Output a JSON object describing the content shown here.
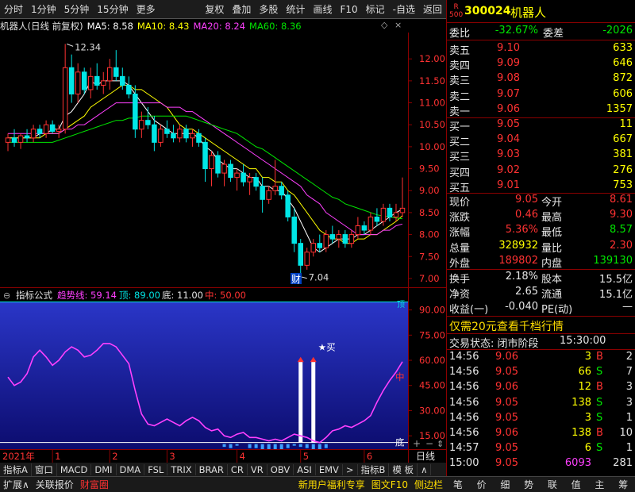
{
  "toolbar": {
    "left": [
      "分时",
      "1分钟",
      "5分钟",
      "15分钟",
      "更多"
    ],
    "right": [
      "复权",
      "叠加",
      "多股",
      "统计",
      "画线",
      "F10",
      "标记",
      "-自选",
      "返回"
    ]
  },
  "chart_header": {
    "name": "机器人(日线 前复权)",
    "ma": [
      {
        "label": "MA5: 8.58",
        "color": "#ffffff"
      },
      {
        "label": "MA10: 8.43",
        "color": "#ffff00"
      },
      {
        "label": "MA20: 8.24",
        "color": "#ff40ff"
      },
      {
        "label": "MA60: 8.36",
        "color": "#00e600"
      }
    ]
  },
  "indicator_header": {
    "name": "指标公式",
    "trend": "趋势线: 59.14",
    "top": "顶: 89.00",
    "bottom": "底: 11.00",
    "mid": "中: 50.00"
  },
  "annotations": {
    "high": "12.34",
    "low": "7.04",
    "cai": "财",
    "buy": "★买",
    "ind_mid": "中",
    "ind_bottom": "底",
    "ind_top": "顶"
  },
  "chart_data": [
    {
      "type": "candlestick",
      "ylim": [
        6.8,
        12.6
      ],
      "yticks": [
        "12.00",
        "11.50",
        "11.00",
        "10.50",
        "10.00",
        "9.50",
        "9.00",
        "8.50",
        "8.00",
        "7.50",
        "7.00"
      ],
      "ytick_values": [
        12,
        11.5,
        11,
        10.5,
        10,
        9.5,
        9,
        8.5,
        8,
        7.5,
        7
      ],
      "ohlc": [
        [
          10.1,
          10.3,
          9.9,
          10.2
        ],
        [
          10.2,
          10.4,
          10.0,
          10.1
        ],
        [
          10.1,
          10.3,
          9.95,
          10.25
        ],
        [
          10.25,
          10.4,
          10.1,
          10.2
        ],
        [
          10.2,
          10.5,
          10.1,
          10.4
        ],
        [
          10.4,
          10.5,
          10.2,
          10.3
        ],
        [
          10.3,
          10.6,
          10.2,
          10.5
        ],
        [
          10.5,
          10.6,
          10.3,
          10.35
        ],
        [
          10.35,
          10.5,
          10.2,
          10.4
        ],
        [
          10.4,
          12.34,
          10.3,
          11.8
        ],
        [
          11.8,
          12.1,
          11.0,
          11.2
        ],
        [
          11.2,
          11.9,
          11.0,
          11.7
        ],
        [
          11.7,
          11.8,
          11.2,
          11.3
        ],
        [
          11.3,
          11.8,
          11.1,
          11.6
        ],
        [
          11.6,
          11.9,
          11.3,
          11.4
        ],
        [
          11.4,
          11.7,
          11.2,
          11.5
        ],
        [
          11.5,
          12.0,
          11.3,
          11.8
        ],
        [
          11.8,
          12.2,
          11.5,
          11.6
        ],
        [
          11.6,
          11.8,
          11.3,
          11.4
        ],
        [
          11.4,
          11.6,
          11.1,
          11.2
        ],
        [
          11.2,
          11.4,
          10.2,
          10.4
        ],
        [
          10.4,
          10.8,
          10.2,
          10.6
        ],
        [
          10.6,
          10.9,
          10.4,
          10.5
        ],
        [
          10.5,
          10.7,
          9.9,
          10.1
        ],
        [
          10.1,
          10.5,
          10.0,
          10.4
        ],
        [
          10.4,
          10.6,
          10.2,
          10.3
        ],
        [
          10.3,
          10.5,
          10.1,
          10.2
        ],
        [
          10.2,
          10.5,
          10.1,
          10.4
        ],
        [
          10.4,
          10.5,
          10.1,
          10.2
        ],
        [
          10.2,
          10.4,
          10.0,
          10.3
        ],
        [
          10.3,
          10.4,
          10.0,
          10.1
        ],
        [
          10.1,
          10.2,
          9.2,
          9.5
        ],
        [
          9.5,
          9.9,
          9.1,
          9.8
        ],
        [
          9.8,
          9.9,
          9.3,
          9.4
        ],
        [
          9.4,
          9.7,
          9.1,
          9.6
        ],
        [
          9.6,
          9.7,
          9.2,
          9.3
        ],
        [
          9.3,
          9.5,
          9.0,
          9.4
        ],
        [
          9.4,
          9.6,
          9.1,
          9.2
        ],
        [
          9.2,
          9.4,
          8.9,
          9.3
        ],
        [
          9.3,
          9.4,
          9.0,
          9.1
        ],
        [
          9.1,
          9.3,
          8.5,
          8.8
        ],
        [
          8.8,
          9.1,
          8.7,
          9.0
        ],
        [
          9.0,
          9.7,
          8.9,
          9.1
        ],
        [
          9.1,
          9.2,
          8.8,
          8.9
        ],
        [
          8.9,
          9.0,
          8.3,
          8.4
        ],
        [
          8.4,
          8.6,
          7.6,
          7.8
        ],
        [
          7.8,
          7.9,
          7.04,
          7.3
        ],
        [
          7.3,
          7.7,
          7.2,
          7.6
        ],
        [
          7.6,
          7.9,
          7.5,
          7.8
        ],
        [
          7.8,
          8.0,
          7.6,
          7.7
        ],
        [
          7.7,
          8.1,
          7.6,
          8.0
        ],
        [
          8.0,
          8.2,
          7.8,
          7.9
        ],
        [
          7.9,
          8.1,
          7.7,
          8.0
        ],
        [
          8.0,
          8.1,
          7.7,
          7.8
        ],
        [
          7.8,
          8.1,
          7.7,
          8.0
        ],
        [
          8.0,
          8.4,
          7.9,
          8.2
        ],
        [
          8.2,
          8.3,
          8.0,
          8.1
        ],
        [
          8.1,
          8.5,
          8.0,
          8.4
        ],
        [
          8.4,
          8.6,
          8.2,
          8.3
        ],
        [
          8.3,
          8.7,
          8.2,
          8.6
        ],
        [
          8.6,
          8.7,
          8.3,
          8.4
        ],
        [
          8.4,
          8.7,
          8.3,
          8.5
        ],
        [
          8.5,
          9.3,
          8.4,
          8.6
        ]
      ],
      "ma_series": [
        {
          "name": "MA5",
          "color": "#ffffff",
          "values": [
            10.2,
            10.2,
            10.2,
            10.2,
            10.2,
            10.3,
            10.3,
            10.4,
            10.4,
            10.7,
            10.8,
            11.0,
            11.2,
            11.5,
            11.4,
            11.5,
            11.5,
            11.5,
            11.5,
            11.4,
            11.2,
            11.0,
            10.8,
            10.6,
            10.5,
            10.4,
            10.3,
            10.3,
            10.3,
            10.3,
            10.2,
            10.0,
            9.9,
            9.7,
            9.6,
            9.5,
            9.5,
            9.4,
            9.3,
            9.3,
            9.1,
            9.1,
            9.0,
            9.0,
            8.8,
            8.6,
            8.3,
            8.0,
            7.7,
            7.6,
            7.7,
            7.8,
            7.9,
            7.9,
            7.9,
            8.0,
            8.0,
            8.1,
            8.2,
            8.3,
            8.4,
            8.5,
            8.58
          ]
        },
        {
          "name": "MA10",
          "color": "#ffff00",
          "values": [
            10.2,
            10.2,
            10.2,
            10.2,
            10.2,
            10.2,
            10.3,
            10.3,
            10.3,
            10.4,
            10.5,
            10.6,
            10.7,
            10.9,
            11.0,
            11.1,
            11.2,
            11.3,
            11.4,
            11.4,
            11.3,
            11.3,
            11.2,
            11.1,
            11.0,
            10.9,
            10.7,
            10.5,
            10.4,
            10.4,
            10.3,
            10.2,
            10.1,
            10.0,
            9.9,
            9.8,
            9.7,
            9.6,
            9.5,
            9.5,
            9.3,
            9.3,
            9.2,
            9.2,
            9.0,
            8.9,
            8.7,
            8.5,
            8.3,
            8.1,
            8.0,
            7.9,
            7.9,
            7.8,
            7.8,
            7.9,
            7.9,
            8.0,
            8.0,
            8.1,
            8.2,
            8.3,
            8.43
          ]
        },
        {
          "name": "MA20",
          "color": "#ff40ff",
          "values": [
            10.3,
            10.3,
            10.3,
            10.3,
            10.3,
            10.3,
            10.3,
            10.3,
            10.3,
            10.4,
            10.4,
            10.5,
            10.5,
            10.6,
            10.7,
            10.8,
            10.9,
            11.0,
            11.0,
            11.0,
            11.0,
            11.0,
            11.0,
            11.0,
            11.0,
            10.9,
            10.9,
            10.9,
            10.8,
            10.8,
            10.7,
            10.6,
            10.5,
            10.4,
            10.3,
            10.2,
            10.1,
            10.0,
            9.9,
            9.8,
            9.7,
            9.6,
            9.5,
            9.4,
            9.3,
            9.2,
            9.1,
            8.9,
            8.8,
            8.7,
            8.5,
            8.4,
            8.3,
            8.2,
            8.1,
            8.0,
            8.0,
            8.0,
            8.0,
            8.1,
            8.1,
            8.2,
            8.24
          ]
        },
        {
          "name": "MA60",
          "color": "#00e600",
          "values": [
            10.1,
            10.1,
            10.1,
            10.1,
            10.1,
            10.1,
            10.1,
            10.1,
            10.15,
            10.2,
            10.25,
            10.3,
            10.35,
            10.4,
            10.45,
            10.5,
            10.55,
            10.6,
            10.6,
            10.65,
            10.65,
            10.7,
            10.7,
            10.7,
            10.7,
            10.7,
            10.7,
            10.7,
            10.7,
            10.65,
            10.6,
            10.55,
            10.5,
            10.45,
            10.4,
            10.35,
            10.3,
            10.2,
            10.1,
            10.0,
            9.95,
            9.85,
            9.75,
            9.65,
            9.55,
            9.45,
            9.35,
            9.25,
            9.15,
            9.05,
            8.95,
            8.85,
            8.8,
            8.7,
            8.65,
            8.6,
            8.55,
            8.5,
            8.45,
            8.42,
            8.4,
            8.38,
            8.36
          ]
        }
      ]
    },
    {
      "type": "line",
      "ylim": [
        8,
        95
      ],
      "yticks": [
        "90.00",
        "75.00",
        "60.00",
        "45.00",
        "30.00",
        "15.00"
      ],
      "ytick_values": [
        90,
        75,
        60,
        45,
        30,
        15
      ],
      "series": [
        {
          "name": "趋势线",
          "color": "#ff40ff",
          "values": [
            50,
            45,
            47,
            52,
            62,
            66,
            62,
            57,
            60,
            65,
            68,
            66,
            62,
            63,
            66,
            70,
            70,
            68,
            63,
            58,
            42,
            28,
            22,
            21,
            23,
            25,
            23,
            21,
            24,
            26,
            24,
            20,
            18,
            19,
            15,
            14,
            16,
            17,
            14,
            14,
            13,
            12,
            13,
            12,
            14,
            16,
            15,
            14,
            12,
            11,
            14,
            18,
            19,
            21,
            20,
            22,
            24,
            27,
            35,
            42,
            48,
            53,
            59.14
          ]
        }
      ],
      "mid_line": 50,
      "bottom_line": 11
    }
  ],
  "x_axis": {
    "year": "2021年",
    "months": [
      "1",
      "2",
      "3",
      "4",
      "5",
      "6"
    ],
    "period": "日线"
  },
  "indicator_tabs": [
    "指标A",
    "窗口",
    "MACD",
    "DMI",
    "DMA",
    "FSL",
    "TRIX",
    "BRAR",
    "CR",
    "VR",
    "OBV",
    "ASI",
    "EMV",
    "指标B",
    "模 板"
  ],
  "status_left": [
    "扩展∧",
    "关联报价",
    "财富圈"
  ],
  "status_right": [
    "新用户福利专享",
    "图文F10",
    "侧边栏"
  ],
  "status_icons": [
    "笔",
    "价",
    "细",
    "势",
    "联",
    "值",
    "主",
    "筹"
  ],
  "stock": {
    "code": "300024",
    "name": "机器人",
    "badge_top": "R",
    "badge_bottom": "500",
    "weibi_label": "委比",
    "weibi": "-32.67%",
    "weicha_label": "委差",
    "weicha": "-2026"
  },
  "asks": [
    {
      "label": "卖五",
      "price": "9.10",
      "vol": "633"
    },
    {
      "label": "卖四",
      "price": "9.09",
      "vol": "646"
    },
    {
      "label": "卖三",
      "price": "9.08",
      "vol": "872"
    },
    {
      "label": "卖二",
      "price": "9.07",
      "vol": "606"
    },
    {
      "label": "卖一",
      "price": "9.06",
      "vol": "1357"
    }
  ],
  "bids": [
    {
      "label": "买一",
      "price": "9.05",
      "vol": "11"
    },
    {
      "label": "买二",
      "price": "9.04",
      "vol": "667"
    },
    {
      "label": "买三",
      "price": "9.03",
      "vol": "381"
    },
    {
      "label": "买四",
      "price": "9.02",
      "vol": "276"
    },
    {
      "label": "买五",
      "price": "9.01",
      "vol": "753"
    }
  ],
  "quote": [
    {
      "l1": "现价",
      "v1": "9.05",
      "c1": "#ff3232",
      "l2": "今开",
      "v2": "8.61",
      "c2": "#ff3232"
    },
    {
      "l1": "涨跌",
      "v1": "0.46",
      "c1": "#ff3232",
      "l2": "最高",
      "v2": "9.30",
      "c2": "#ff3232"
    },
    {
      "l1": "涨幅",
      "v1": "5.36%",
      "c1": "#ff3232",
      "l2": "最低",
      "v2": "8.57",
      "c2": "#00e600"
    },
    {
      "l1": "总量",
      "v1": "328932",
      "c1": "#ffff00",
      "l2": "量比",
      "v2": "2.30",
      "c2": "#ff3232"
    },
    {
      "l1": "外盘",
      "v1": "189802",
      "c1": "#ff3232",
      "l2": "内盘",
      "v2": "139130",
      "c2": "#00e600"
    }
  ],
  "stats": [
    {
      "l1": "换手",
      "v1": "2.18%",
      "l2": "股本",
      "v2": "15.5亿"
    },
    {
      "l1": "净资",
      "v1": "2.65",
      "l2": "流通",
      "v2": "15.1亿"
    },
    {
      "l1": "收益(一)",
      "v1": "-0.040",
      "l2": "PE(动)",
      "v2": "—"
    }
  ],
  "promo": "仅需20元查看千档行情",
  "trade_status_label": "交易状态: 闭市阶段",
  "trade_status_time": "15:30:00",
  "ticks": [
    {
      "time": "14:56",
      "price": "9.06",
      "vol": "3",
      "bs": "B",
      "n": "2",
      "pc": "#ff3232",
      "bc": "#ff3232",
      "vc": "#ffff00"
    },
    {
      "time": "14:56",
      "price": "9.05",
      "vol": "66",
      "bs": "S",
      "n": "7",
      "pc": "#ff3232",
      "bc": "#00e600",
      "vc": "#ffff00"
    },
    {
      "time": "14:56",
      "price": "9.06",
      "vol": "12",
      "bs": "B",
      "n": "3",
      "pc": "#ff3232",
      "bc": "#ff3232",
      "vc": "#ffff00"
    },
    {
      "time": "14:56",
      "price": "9.05",
      "vol": "138",
      "bs": "S",
      "n": "3",
      "pc": "#ff3232",
      "bc": "#00e600",
      "vc": "#ffff00"
    },
    {
      "time": "14:56",
      "price": "9.05",
      "vol": "3",
      "bs": "S",
      "n": "1",
      "pc": "#ff3232",
      "bc": "#00e600",
      "vc": "#ffff00"
    },
    {
      "time": "14:56",
      "price": "9.06",
      "vol": "138",
      "bs": "B",
      "n": "10",
      "pc": "#ff3232",
      "bc": "#ff3232",
      "vc": "#ffff00"
    },
    {
      "time": "14:57",
      "price": "9.05",
      "vol": "6",
      "bs": "S",
      "n": "1",
      "pc": "#ff3232",
      "bc": "#00e600",
      "vc": "#ffff00"
    },
    {
      "time": "15:00",
      "price": "9.05",
      "vol": "6093",
      "bs": "",
      "n": "281",
      "pc": "#ff3232",
      "bc": "#ffffff",
      "vc": "#ff40ff"
    }
  ]
}
